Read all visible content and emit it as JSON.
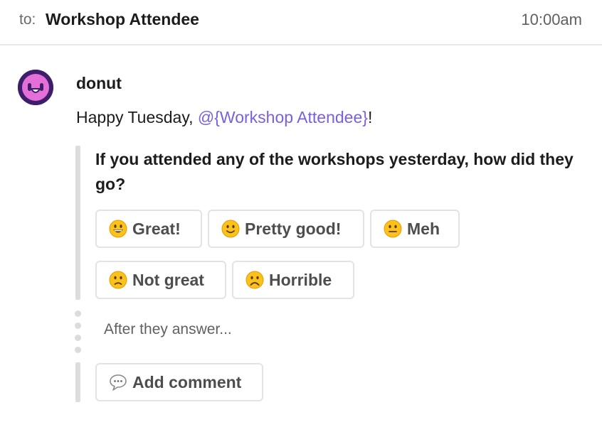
{
  "header": {
    "to_label": "to:",
    "recipient": "Workshop Attendee",
    "time": "10:00am"
  },
  "message": {
    "sender": "donut",
    "greeting_prefix": "Happy Tuesday, ",
    "mention": "@{Workshop Attendee}",
    "greeting_suffix": "!",
    "question": "If you attended any of the workshops yesterday, how did they go?",
    "options": [
      {
        "label": "Great!",
        "icon": "grinning-face-icon"
      },
      {
        "label": "Pretty good!",
        "icon": "slightly-smiling-face-icon"
      },
      {
        "label": "Meh",
        "icon": "neutral-face-icon"
      },
      {
        "label": "Not great",
        "icon": "slightly-frowning-face-icon"
      },
      {
        "label": "Horrible",
        "icon": "frowning-face-icon"
      }
    ],
    "after_text": "After they answer...",
    "comment_button": {
      "label": "Add comment",
      "icon": "speech-balloon-icon"
    }
  },
  "colors": {
    "mention": "#7b5fdc",
    "avatar_bg": "#3d1e6b",
    "avatar_face": "#e46fd8",
    "emoji_yellow": "#fcc21b"
  }
}
